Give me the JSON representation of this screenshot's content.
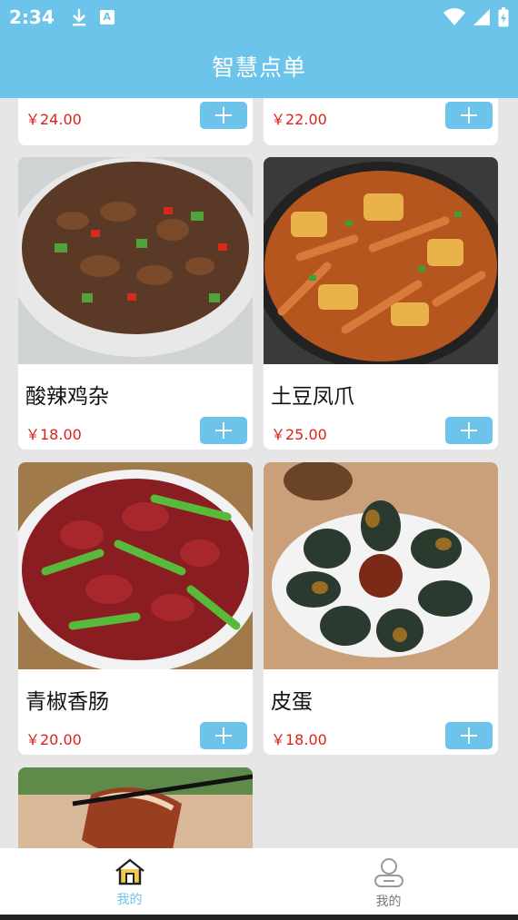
{
  "status_bar": {
    "time": "2:34",
    "icons": [
      "download-icon",
      "a-badge-icon",
      "wifi-icon",
      "signal-icon",
      "battery-icon"
    ],
    "badge_letter": "A"
  },
  "app_bar": {
    "title": "智慧点单"
  },
  "colors": {
    "accent": "#6cc4ea",
    "price": "#d9231c"
  },
  "dishes_partial": [
    {
      "price": "￥24.00"
    },
    {
      "price": "￥22.00"
    }
  ],
  "dishes": [
    {
      "name": "酸辣鸡杂",
      "price": "￥18.00"
    },
    {
      "name": "土豆凤爪",
      "price": "￥25.00"
    },
    {
      "name": "青椒香肠",
      "price": "￥20.00"
    },
    {
      "name": "皮蛋",
      "price": "￥18.00"
    }
  ],
  "bottom_nav": [
    {
      "label": "我的",
      "icon": "home-icon",
      "active": true
    },
    {
      "label": "我的",
      "icon": "user-icon",
      "active": false
    }
  ]
}
